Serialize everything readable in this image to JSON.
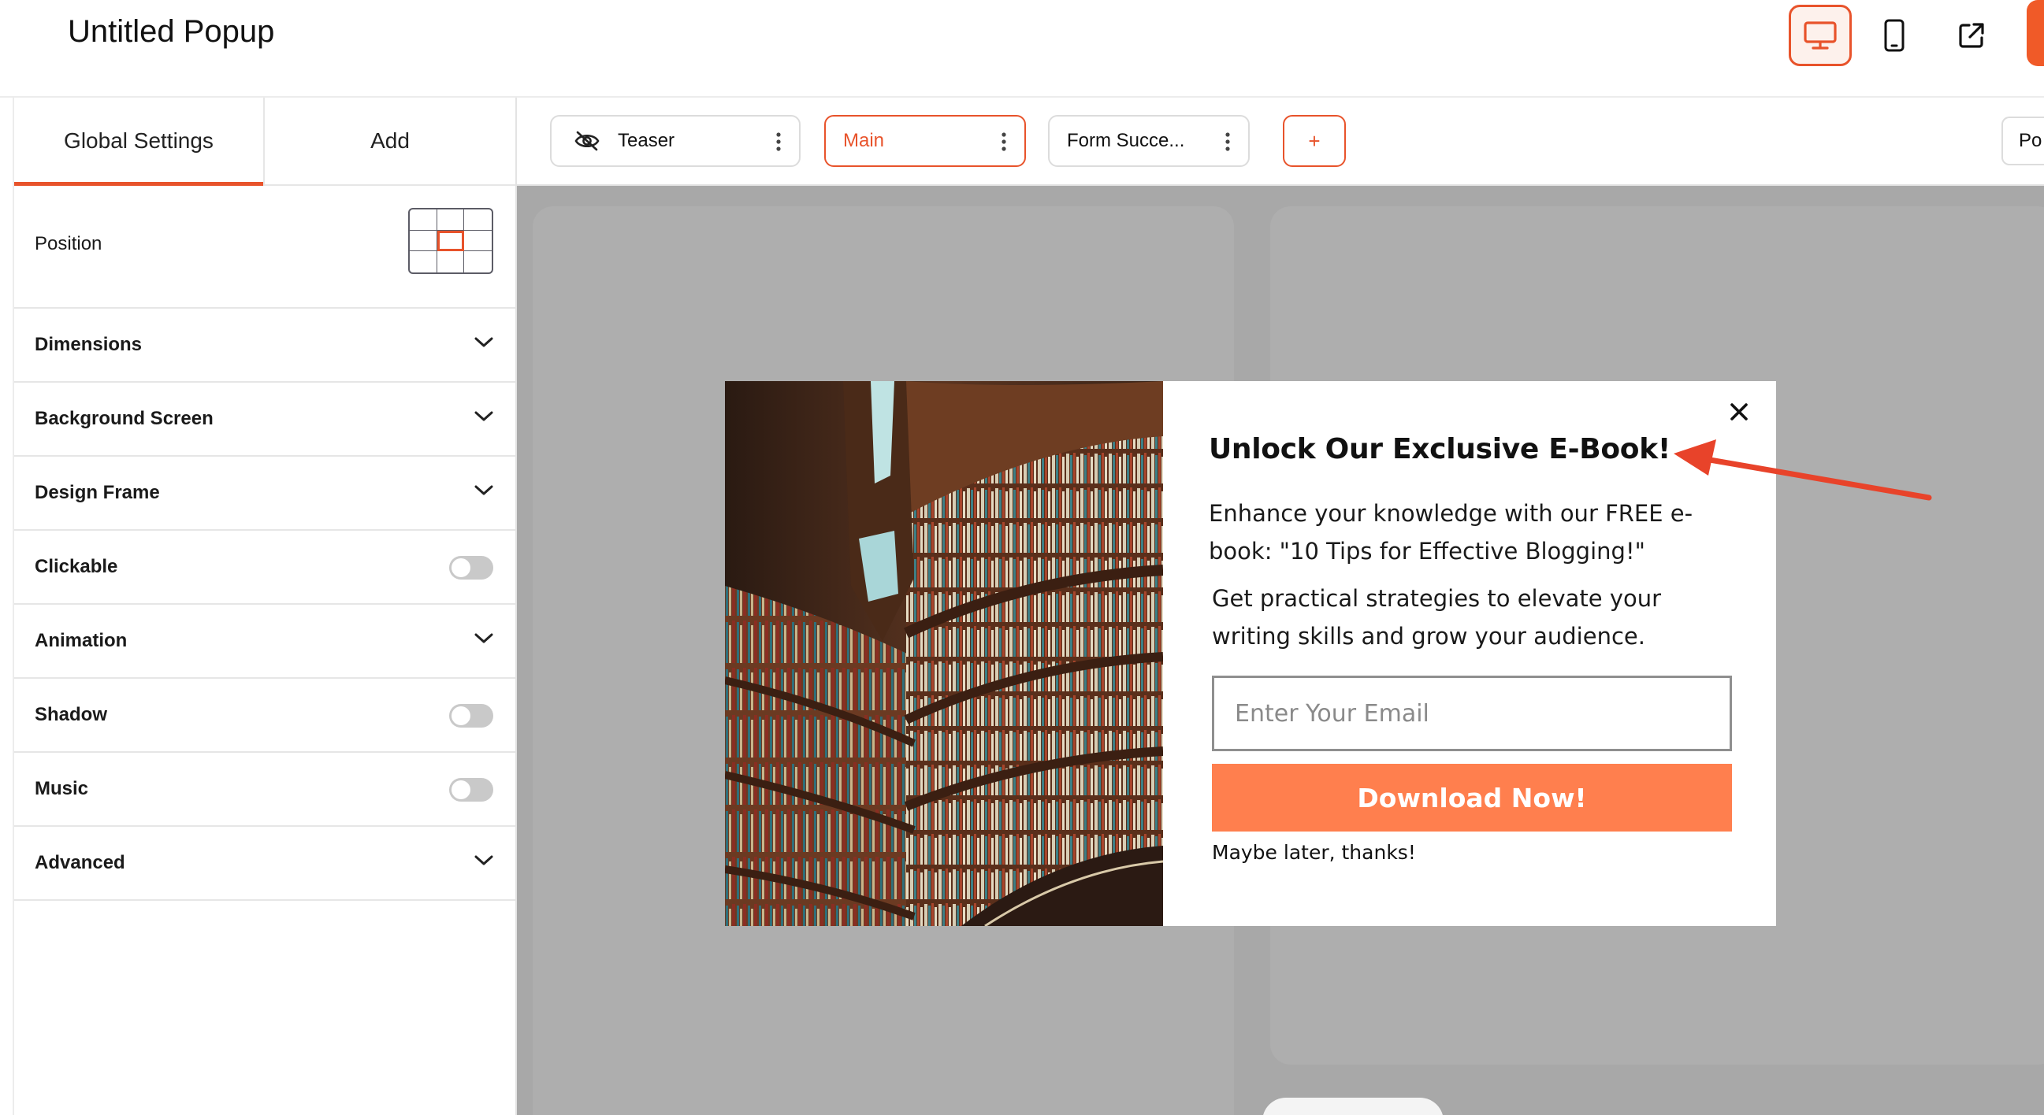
{
  "header": {
    "title": "Untitled Popup",
    "icons": [
      "desktop-icon",
      "mobile-icon",
      "external-link-icon"
    ],
    "accent": "#e8532b"
  },
  "sidebar": {
    "tabs": [
      {
        "label": "Global Settings",
        "active": true
      },
      {
        "label": "Add",
        "active": false
      }
    ],
    "position_label": "Position",
    "rows": [
      {
        "label": "Dimensions",
        "control": "chevron"
      },
      {
        "label": "Background Screen",
        "control": "chevron"
      },
      {
        "label": "Design Frame",
        "control": "chevron"
      },
      {
        "label": "Clickable",
        "control": "toggle",
        "on": false
      },
      {
        "label": "Animation",
        "control": "chevron"
      },
      {
        "label": "Shadow",
        "control": "toggle",
        "on": false
      },
      {
        "label": "Music",
        "control": "toggle",
        "on": false
      },
      {
        "label": "Advanced",
        "control": "chevron"
      }
    ]
  },
  "steps": {
    "items": [
      {
        "label": "Teaser",
        "icon": "eye-off-icon"
      },
      {
        "label": "Main",
        "active": true
      },
      {
        "label": "Form Succe..."
      }
    ],
    "add_label": "+",
    "right_partial_label": "Po"
  },
  "popup": {
    "title": "Unlock Our Exclusive E-Book!",
    "body1": "Enhance your knowledge with our FREE e-book: \"10 Tips for Effective Blogging!\"",
    "body2": "Get practical strategies to elevate your writing skills and grow your audience.",
    "email_placeholder": "Enter Your Email",
    "button_label": "Download Now!",
    "dismiss_label": "Maybe later, thanks!",
    "button_color": "#ff7f4e"
  }
}
